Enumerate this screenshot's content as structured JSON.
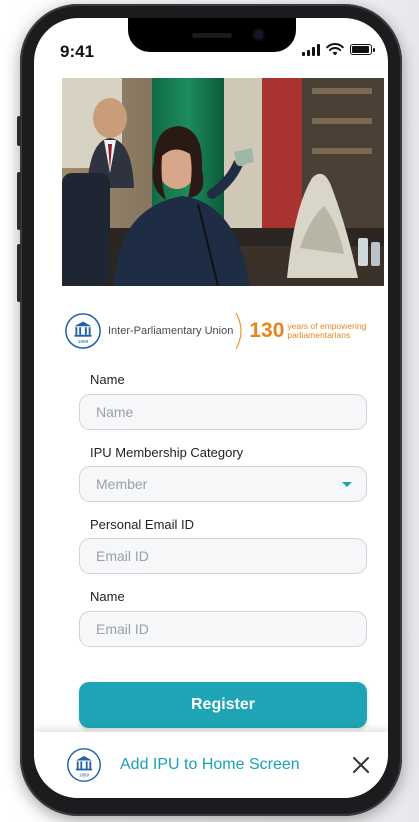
{
  "status_bar": {
    "time": "9:41"
  },
  "hero_image": {
    "alt": ""
  },
  "branding": {
    "org_name": "Inter-Parliamentary Union",
    "anniversary_number": "130",
    "anniversary_tagline_line1": "years of empowering",
    "anniversary_tagline_line2": "parliamentarians",
    "logo_year": "1889"
  },
  "form": {
    "name_label": "Name",
    "name_placeholder": "Name",
    "category_label": "IPU Membership Category",
    "category_selected": "Member",
    "email_label": "Personal Email ID",
    "email_placeholder": "Email ID",
    "name2_label": "Name",
    "name2_placeholder": "Email ID",
    "register_label": "Register"
  },
  "install_banner": {
    "text": "Add IPU to Home Screen",
    "logo_year": "1889"
  },
  "colors": {
    "accent": "#1ea4b4",
    "banner_text": "#1aa0b6",
    "anniversary": "#e8841c",
    "logo_blue": "#1f62a8"
  }
}
